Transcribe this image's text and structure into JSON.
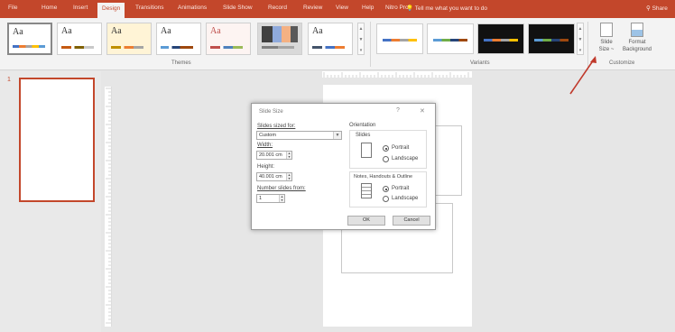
{
  "ribbon_tabs": [
    "File",
    "Home",
    "Insert",
    "Design",
    "Transitions",
    "Animations",
    "Slide Show",
    "Record",
    "Review",
    "View",
    "Help",
    "Nitro Pro"
  ],
  "active_tab": "Design",
  "tell_me": "Tell me what you want to do",
  "share": "Share",
  "themes": {
    "label": "Themes",
    "items": [
      {
        "text": "Aa",
        "accent": "#4472c4"
      },
      {
        "text": "Aa",
        "accent": "#c55a11"
      },
      {
        "text": "Aa",
        "accent": "#bf9000"
      },
      {
        "text": "Aa",
        "accent": "#5b9bd5"
      },
      {
        "text": "Aa",
        "accent": "#c0504d"
      },
      {
        "text": "",
        "accent": "#7f7f7f"
      },
      {
        "text": "Aa",
        "accent": "#44546a"
      }
    ]
  },
  "variants": {
    "label": "Variants"
  },
  "customize": {
    "label": "Customize",
    "slide_size_line1": "Slide",
    "slide_size_line2": "Size ~",
    "format_bg_line1": "Format",
    "format_bg_line2": "Background"
  },
  "slide_number": "1",
  "dialog": {
    "title": "Slide Size",
    "help": "?",
    "close": "✕",
    "slides_sized_for_label": "Slides sized for:",
    "slides_sized_for_value": "Custom",
    "width_label": "Width:",
    "width_value": "20.001 cm",
    "height_label": "Height:",
    "height_value": "40.001 cm",
    "number_from_label": "Number slides from:",
    "number_from_value": "1",
    "orientation_label": "Orientation",
    "slides_group_label": "Slides",
    "portrait_label": "Portrait",
    "landscape_label": "Landscape",
    "notes_group_label": "Notes, Handouts & Outline",
    "notes_portrait_label": "Portrait",
    "notes_landscape_label": "Landscape",
    "ok_label": "OK",
    "cancel_label": "Cancel"
  },
  "colors": {
    "ribbon_accent": "#c3472b",
    "annotation_arrow": "#c0392b"
  }
}
